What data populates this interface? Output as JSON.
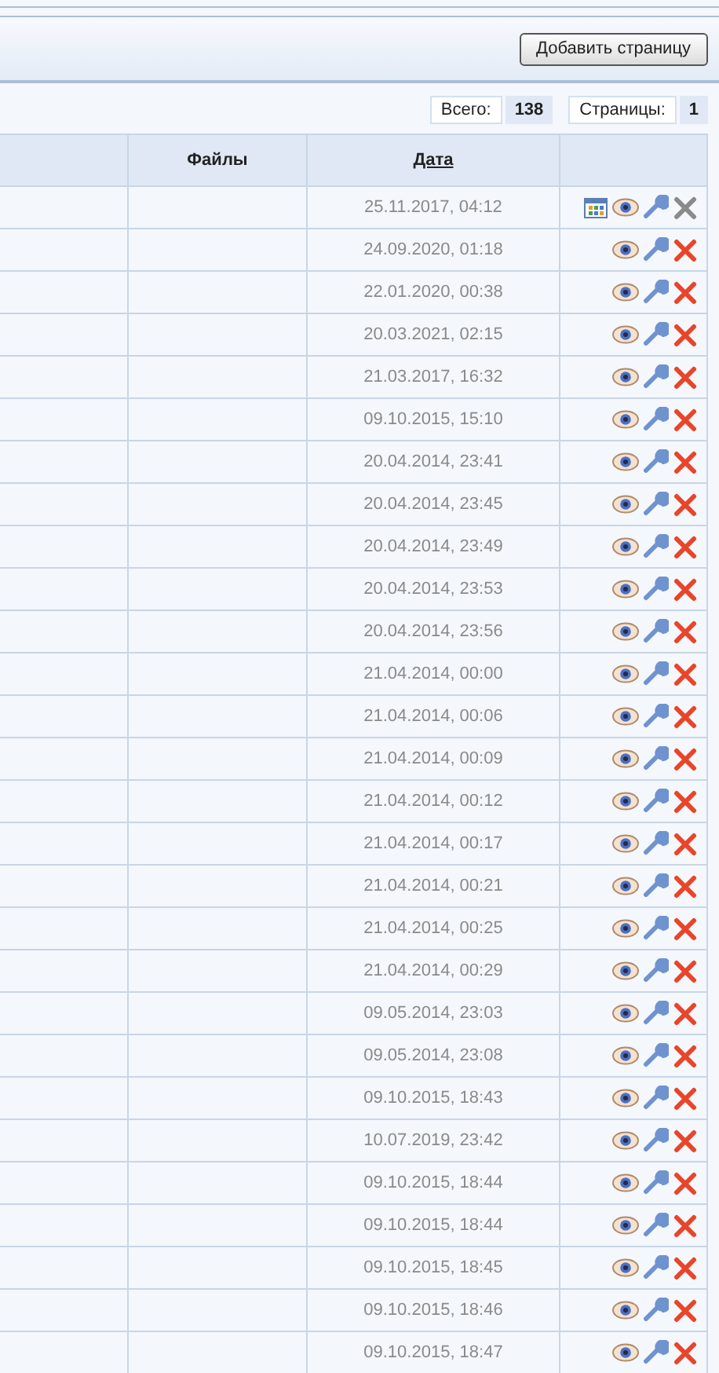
{
  "toolbar": {
    "add_button": "Добавить страницу"
  },
  "stats": [
    {
      "label": "Всего:",
      "value": "138"
    },
    {
      "label": "Страницы:",
      "value": "1"
    }
  ],
  "table": {
    "columns": [
      {
        "label": "Файлы",
        "sortable": false
      },
      {
        "label": "Дата",
        "sortable": true
      }
    ],
    "rows": [
      {
        "date": "25.11.2017, 04:12",
        "table_icon": true,
        "delete_enabled": false
      },
      {
        "date": "24.09.2020, 01:18",
        "table_icon": false,
        "delete_enabled": true
      },
      {
        "date": "22.01.2020, 00:38",
        "table_icon": false,
        "delete_enabled": true
      },
      {
        "date": "20.03.2021, 02:15",
        "table_icon": false,
        "delete_enabled": true
      },
      {
        "date": "21.03.2017, 16:32",
        "table_icon": false,
        "delete_enabled": true
      },
      {
        "date": "09.10.2015, 15:10",
        "table_icon": false,
        "delete_enabled": true
      },
      {
        "date": "20.04.2014, 23:41",
        "table_icon": false,
        "delete_enabled": true
      },
      {
        "date": "20.04.2014, 23:45",
        "table_icon": false,
        "delete_enabled": true
      },
      {
        "date": "20.04.2014, 23:49",
        "table_icon": false,
        "delete_enabled": true
      },
      {
        "date": "20.04.2014, 23:53",
        "table_icon": false,
        "delete_enabled": true
      },
      {
        "date": "20.04.2014, 23:56",
        "table_icon": false,
        "delete_enabled": true
      },
      {
        "date": "21.04.2014, 00:00",
        "table_icon": false,
        "delete_enabled": true
      },
      {
        "date": "21.04.2014, 00:06",
        "table_icon": false,
        "delete_enabled": true
      },
      {
        "date": "21.04.2014, 00:09",
        "table_icon": false,
        "delete_enabled": true
      },
      {
        "date": "21.04.2014, 00:12",
        "table_icon": false,
        "delete_enabled": true
      },
      {
        "date": "21.04.2014, 00:17",
        "table_icon": false,
        "delete_enabled": true
      },
      {
        "date": "21.04.2014, 00:21",
        "table_icon": false,
        "delete_enabled": true
      },
      {
        "date": "21.04.2014, 00:25",
        "table_icon": false,
        "delete_enabled": true
      },
      {
        "date": "21.04.2014, 00:29",
        "table_icon": false,
        "delete_enabled": true
      },
      {
        "date": "09.05.2014, 23:03",
        "table_icon": false,
        "delete_enabled": true
      },
      {
        "date": "09.05.2014, 23:08",
        "table_icon": false,
        "delete_enabled": true
      },
      {
        "date": "09.10.2015, 18:43",
        "table_icon": false,
        "delete_enabled": true
      },
      {
        "date": "10.07.2019, 23:42",
        "table_icon": false,
        "delete_enabled": true
      },
      {
        "date": "09.10.2015, 18:44",
        "table_icon": false,
        "delete_enabled": true
      },
      {
        "date": "09.10.2015, 18:44",
        "table_icon": false,
        "delete_enabled": true
      },
      {
        "date": "09.10.2015, 18:45",
        "table_icon": false,
        "delete_enabled": true
      },
      {
        "date": "09.10.2015, 18:46",
        "table_icon": false,
        "delete_enabled": true
      },
      {
        "date": "09.10.2015, 18:47",
        "table_icon": false,
        "delete_enabled": true
      }
    ]
  }
}
